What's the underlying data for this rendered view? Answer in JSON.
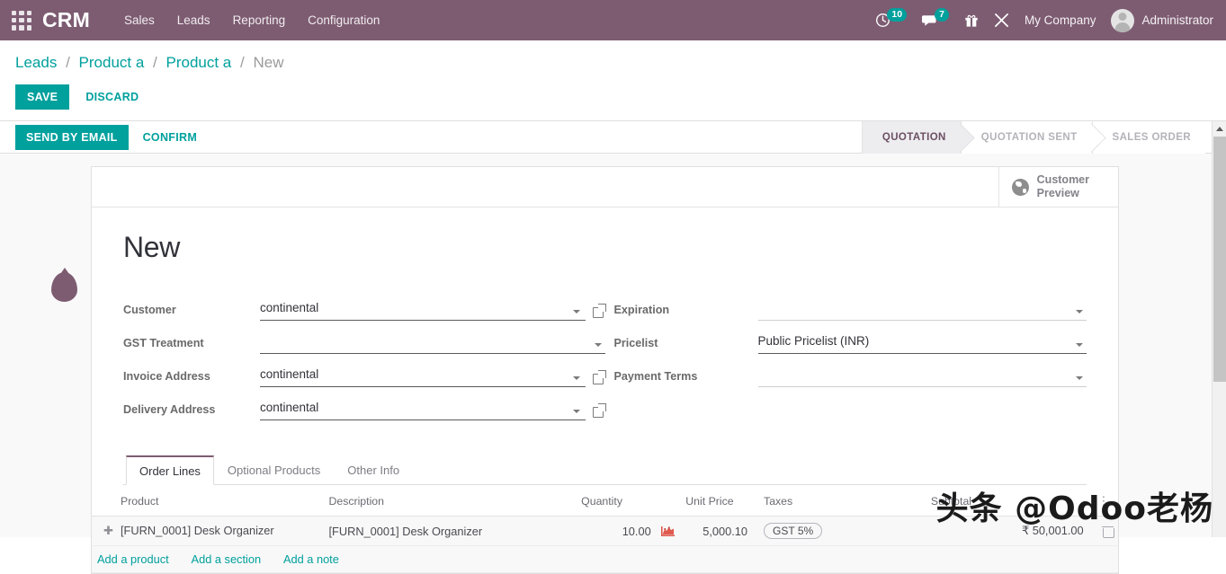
{
  "navbar": {
    "apps_icon": "apps-grid-icon",
    "brand": "CRM",
    "menu": [
      {
        "label": "Sales"
      },
      {
        "label": "Leads"
      },
      {
        "label": "Reporting"
      },
      {
        "label": "Configuration"
      }
    ],
    "activity_icon": "clock-activity-icon",
    "activity_count": "10",
    "messages_icon": "speech-bubble-icon",
    "messages_count": "7",
    "gift_icon": "gift-icon",
    "tools_icon": "tools-icon",
    "company": "My Company",
    "user": "Administrator",
    "avatar_icon": "user-avatar",
    "bg_color": "#7d5c72",
    "badge_color": "#00a09d"
  },
  "breadcrumb": {
    "items": [
      {
        "label": "Leads",
        "current": false
      },
      {
        "label": "Product a",
        "current": false
      },
      {
        "label": "Product a",
        "current": false
      },
      {
        "label": "New",
        "current": true
      }
    ],
    "separator": "/"
  },
  "control_panel": {
    "save_label": "SAVE",
    "discard_label": "DISCARD",
    "accent_color": "#00a09d"
  },
  "statusbar": {
    "send_by_email_label": "SEND BY EMAIL",
    "confirm_label": "CONFIRM",
    "stages": [
      {
        "label": "QUOTATION",
        "active": true
      },
      {
        "label": "QUOTATION SENT",
        "active": false
      },
      {
        "label": "SALES ORDER",
        "active": false
      }
    ]
  },
  "stat_buttons": [
    {
      "icon": "globe-icon",
      "line1": "Customer",
      "line2": "Preview"
    }
  ],
  "record": {
    "title": "New"
  },
  "form": {
    "left_fields": [
      {
        "label": "Customer",
        "value": "continental",
        "placeholder": "",
        "has_external_link": true,
        "has_dropdown": true,
        "underline": "dark"
      },
      {
        "label": "GST Treatment",
        "value": "",
        "placeholder": "",
        "has_external_link": false,
        "has_dropdown": true,
        "underline": "dark"
      },
      {
        "label": "Invoice Address",
        "value": "continental",
        "placeholder": "",
        "has_external_link": true,
        "has_dropdown": true,
        "underline": "dark"
      },
      {
        "label": "Delivery Address",
        "value": "continental",
        "placeholder": "",
        "has_external_link": true,
        "has_dropdown": true,
        "underline": "dark"
      }
    ],
    "right_fields": [
      {
        "label": "Expiration",
        "value": "",
        "placeholder": "",
        "has_external_link": false,
        "has_dropdown": true,
        "underline": "light"
      },
      {
        "label": "Pricelist",
        "value": "Public Pricelist (INR)",
        "placeholder": "",
        "has_external_link": false,
        "has_dropdown": true,
        "underline": "dark"
      },
      {
        "label": "Payment Terms",
        "value": "",
        "placeholder": "",
        "has_external_link": false,
        "has_dropdown": true,
        "underline": "light"
      }
    ]
  },
  "notebook": {
    "tabs": [
      {
        "label": "Order Lines",
        "active": true
      },
      {
        "label": "Optional Products",
        "active": false
      },
      {
        "label": "Other Info",
        "active": false
      }
    ]
  },
  "order_lines": {
    "columns": [
      "Product",
      "Description",
      "Quantity",
      "Unit Price",
      "Taxes",
      "Subtotal"
    ],
    "optional_columns_icon": "column-options-icon",
    "rows": [
      {
        "drag_handle_icon": "drag-handle-icon",
        "product": "[FURN_0001] Desk Organizer",
        "description": "[FURN_0001] Desk Organizer",
        "quantity": "10.00",
        "forecast_icon": "forecast-chart-icon",
        "unit_price": "5,000.10",
        "taxes": "GST 5%",
        "subtotal": "₹ 50,001.00",
        "delete_icon": "trash-icon"
      }
    ],
    "add_links": [
      {
        "label": "Add a product"
      },
      {
        "label": "Add a section"
      },
      {
        "label": "Add a note"
      }
    ]
  },
  "watermark": {
    "text": "头条 @Odoo老杨"
  },
  "scrollbar": {
    "up_arrow_icon": "scroll-up-arrow-icon"
  }
}
